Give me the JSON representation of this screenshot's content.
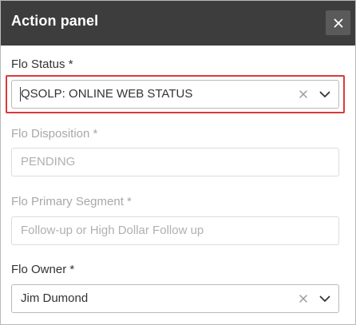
{
  "panel": {
    "title": "Action panel",
    "close_icon": "close-icon"
  },
  "fields": {
    "status": {
      "label": "Flo Status *",
      "value": "QSOLP: ONLINE WEB STATUS",
      "highlighted": true
    },
    "disposition": {
      "label": "Flo Disposition *",
      "placeholder": "PENDING",
      "disabled": true
    },
    "segment": {
      "label": "Flo Primary Segment *",
      "placeholder": "Follow-up or High Dollar Follow up",
      "disabled": true
    },
    "owner": {
      "label": "Flo Owner *",
      "value": "Jim Dumond"
    }
  },
  "colors": {
    "header_bg": "#3d3d3d",
    "highlight": "#d93a3a"
  }
}
